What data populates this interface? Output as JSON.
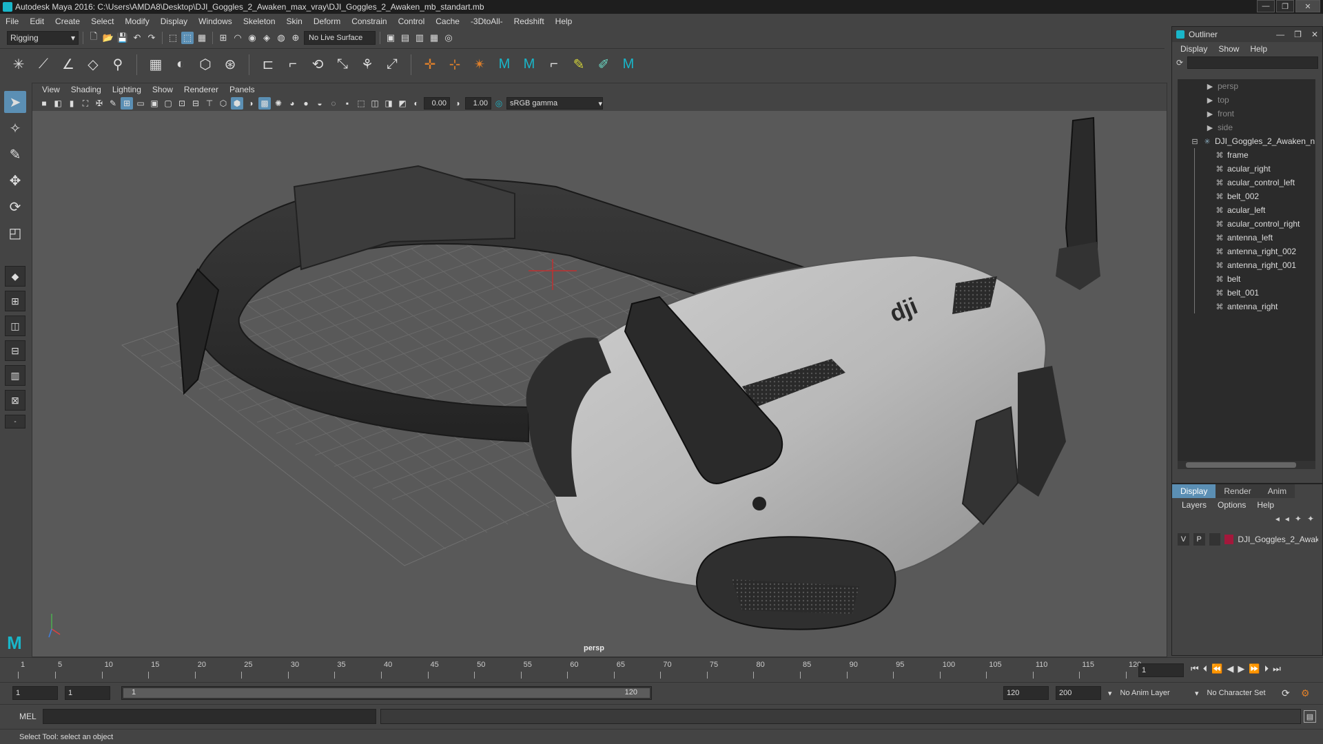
{
  "window": {
    "title": "Autodesk Maya 2016: C:\\Users\\AMDA8\\Desktop\\DJI_Goggles_2_Awaken_max_vray\\DJI_Goggles_2_Awaken_mb_standart.mb",
    "minimize": "—",
    "maximize": "❐",
    "close": "✕"
  },
  "menubar": [
    "File",
    "Edit",
    "Create",
    "Select",
    "Modify",
    "Display",
    "Windows",
    "Skeleton",
    "Skin",
    "Deform",
    "Constrain",
    "Control",
    "Cache",
    "-3DtoAll-",
    "Redshift",
    "Help"
  ],
  "statusline": {
    "menuset": "Rigging",
    "live_surface": "No Live Surface"
  },
  "viewport": {
    "menu": [
      "View",
      "Shading",
      "Lighting",
      "Show",
      "Renderer",
      "Panels"
    ],
    "exposure": "0.00",
    "gamma": "1.00",
    "colorspace": "sRGB gamma",
    "camera": "persp",
    "logo_text": "dji"
  },
  "outliner": {
    "title": "Outliner",
    "menu": [
      "Display",
      "Show",
      "Help"
    ],
    "items": [
      {
        "label": "persp",
        "kind": "camera"
      },
      {
        "label": "top",
        "kind": "camera"
      },
      {
        "label": "front",
        "kind": "camera"
      },
      {
        "label": "side",
        "kind": "camera"
      },
      {
        "label": "DJI_Goggles_2_Awaken_n",
        "kind": "root"
      },
      {
        "label": "frame",
        "kind": "child"
      },
      {
        "label": "acular_right",
        "kind": "child"
      },
      {
        "label": "acular_control_left",
        "kind": "child"
      },
      {
        "label": "belt_002",
        "kind": "child"
      },
      {
        "label": "acular_left",
        "kind": "child"
      },
      {
        "label": "acular_control_right",
        "kind": "child"
      },
      {
        "label": "antenna_left",
        "kind": "child"
      },
      {
        "label": "antenna_right_002",
        "kind": "child"
      },
      {
        "label": "antenna_right_001",
        "kind": "child"
      },
      {
        "label": "belt",
        "kind": "child"
      },
      {
        "label": "belt_001",
        "kind": "child"
      },
      {
        "label": "antenna_right",
        "kind": "child"
      }
    ]
  },
  "layer_editor": {
    "tabs": [
      "Display",
      "Render",
      "Anim"
    ],
    "menu": [
      "Layers",
      "Options",
      "Help"
    ],
    "layer": {
      "v": "V",
      "p": "P",
      "name": "DJI_Goggles_2_Awake",
      "color": "#a3183b"
    }
  },
  "timeline": {
    "ticks": [
      "1",
      "5",
      "10",
      "15",
      "20",
      "25",
      "30",
      "35",
      "40",
      "45",
      "50",
      "55",
      "60",
      "65",
      "70",
      "75",
      "80",
      "85",
      "90",
      "95",
      "100",
      "105",
      "110",
      "115",
      "120"
    ],
    "current_frame": "1"
  },
  "range": {
    "start_time": "1",
    "playback_start": "1",
    "range_start_label": "1",
    "range_end_label": "120",
    "playback_end": "120",
    "end_time": "200",
    "anim_layer": "No Anim Layer",
    "character_set": "No Character Set"
  },
  "cmdline": {
    "label": "MEL"
  },
  "helpline": {
    "text": "Select Tool: select an object"
  }
}
